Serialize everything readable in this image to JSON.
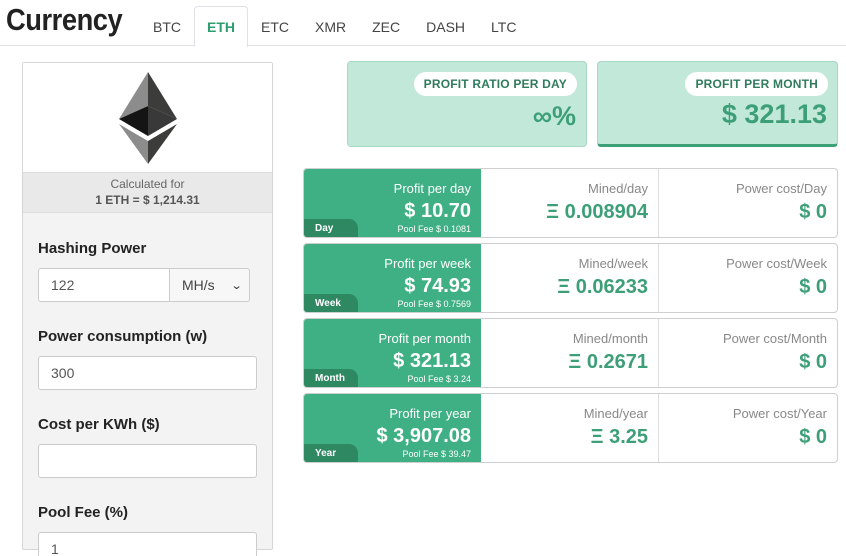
{
  "header": {
    "title": "Currency",
    "tabs": [
      "BTC",
      "ETH",
      "ETC",
      "XMR",
      "ZEC",
      "DASH",
      "LTC"
    ],
    "active_tab": "ETH"
  },
  "left": {
    "logo_icon": "ethereum-logo-icon",
    "calculated_for_label": "Calculated for",
    "rate": "1 ETH = $ 1,214.31",
    "hashing_power": {
      "label": "Hashing Power",
      "value": "122",
      "unit": "MH/s"
    },
    "power_consumption": {
      "label": "Power consumption (w)",
      "value": "300"
    },
    "cost_per_kwh": {
      "label": "Cost per KWh ($)",
      "value": ""
    },
    "pool_fee": {
      "label": "Pool Fee (%)",
      "value": "1"
    }
  },
  "summary": {
    "ratio_label": "PROFIT RATIO PER DAY",
    "ratio_value": "∞%",
    "month_label": "PROFIT PER MONTH",
    "month_value": "$ 321.13"
  },
  "rows": [
    {
      "tag": "Day",
      "profit_label": "Profit per day",
      "profit": "$ 10.70",
      "fee": "Pool Fee $ 0.1081",
      "mined_label": "Mined/day",
      "mined": "Ξ 0.008904",
      "power_label": "Power cost/Day",
      "power": "$ 0"
    },
    {
      "tag": "Week",
      "profit_label": "Profit per week",
      "profit": "$ 74.93",
      "fee": "Pool Fee $ 0.7569",
      "mined_label": "Mined/week",
      "mined": "Ξ 0.06233",
      "power_label": "Power cost/Week",
      "power": "$ 0"
    },
    {
      "tag": "Month",
      "profit_label": "Profit per month",
      "profit": "$ 321.13",
      "fee": "Pool Fee $ 3.24",
      "mined_label": "Mined/month",
      "mined": "Ξ 0.2671",
      "power_label": "Power cost/Month",
      "power": "$ 0"
    },
    {
      "tag": "Year",
      "profit_label": "Profit per year",
      "profit": "$ 3,907.08",
      "fee": "Pool Fee $ 39.47",
      "mined_label": "Mined/year",
      "mined": "Ξ 3.25",
      "power_label": "Power cost/Year",
      "power": "$ 0"
    }
  ],
  "colors": {
    "accent": "#3fb083",
    "accent_dark": "#2e8963",
    "card_bg": "#c2e8da",
    "value_text": "#3d9f78"
  }
}
